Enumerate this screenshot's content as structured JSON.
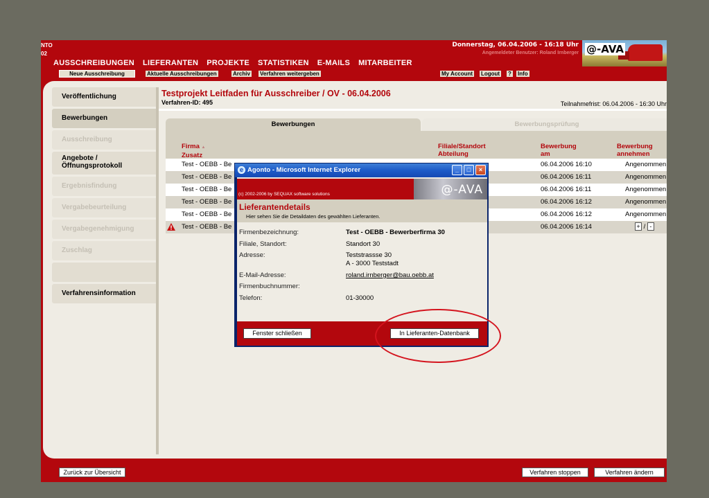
{
  "header": {
    "left_lines": [
      "NTO",
      "02"
    ],
    "date_time": "Donnerstag, 06.04.2006 - 16:18 Uhr",
    "user": "Angemeldeter Benutzer: Roland Irnberger",
    "logo_text": "@-AVA"
  },
  "main_nav": [
    {
      "label": "AUSSCHREIBUNGEN",
      "state": "active"
    },
    {
      "label": "LIEFERANTEN",
      "state": "inactive"
    },
    {
      "label": "PROJEKTE",
      "state": "inactive"
    },
    {
      "label": "STATISTIKEN",
      "state": "inactive"
    },
    {
      "label": "E-MAILS",
      "state": "inactive"
    },
    {
      "label": "MITARBEITER",
      "state": "inactive"
    }
  ],
  "sub_nav": {
    "new_tender": "Neue Ausschreibung",
    "current": "Aktuelle Ausschreibungen",
    "archive": "Archiv",
    "forward": "Verfahren weitergeben",
    "my_account": "My Account",
    "logout": "Logout",
    "help": "?",
    "info": "Info"
  },
  "sidebar": [
    {
      "label": "Veröffentlichung",
      "state": "normal"
    },
    {
      "label": "Bewerbungen",
      "state": "active"
    },
    {
      "label": "Ausschreibung",
      "state": "disabled"
    },
    {
      "label": "Angebote /",
      "label2": "Öffnungsprotokoll",
      "state": "normal"
    },
    {
      "label": "Ergebnisfindung",
      "state": "disabled"
    },
    {
      "label": "Vergabebeurteilung",
      "state": "disabled"
    },
    {
      "label": "Vergabegenehmigung",
      "state": "disabled"
    },
    {
      "label": "Zuschlag",
      "state": "disabled"
    },
    {
      "label": "",
      "state": "blank"
    },
    {
      "label": "Verfahrensinformation",
      "state": "normal"
    }
  ],
  "page": {
    "title": "Testprojekt Leitfaden für Ausschreiber / OV - 06.04.2006",
    "procedure_id": "Verfahren-ID: 495",
    "deadline": "Teilnahmefrist: 06.04.2006 - 16:30 Uhr"
  },
  "tabs": {
    "active": "Bewerbungen",
    "inactive": "Bewerbungsprüfung"
  },
  "table": {
    "headers": {
      "company": "Firma",
      "company_sort": "▲",
      "company2": "Zusatz",
      "branch": "Filiale/Standort",
      "branch2": "Abteilung",
      "applied": "Bewerbung",
      "applied2": "am",
      "accept": "Bewerbung",
      "accept2": "annehmen"
    },
    "rows": [
      {
        "company": "Test - OEBB - Be",
        "date": "06.04.2006 16:10",
        "status": "Angenommen"
      },
      {
        "company": "Test - OEBB - Be",
        "date": "06.04.2006 16:11",
        "status": "Angenommen"
      },
      {
        "company": "Test - OEBB - Be",
        "date": "06.04.2006 16:11",
        "status": "Angenommen"
      },
      {
        "company": "Test - OEBB - Be",
        "date": "06.04.2006 16:12",
        "status": "Angenommen"
      },
      {
        "company": "Test - OEBB - Be",
        "date": "06.04.2006 16:12",
        "status": "Angenommen"
      },
      {
        "company": "Test - OEBB - Be",
        "date": "06.04.2006 16:14",
        "status": "",
        "accept_plus": "+",
        "accept_sep": "/",
        "accept_minus": "-"
      }
    ]
  },
  "footer": {
    "back": "Zurück zur Übersicht",
    "stop": "Verfahren stoppen",
    "change": "Verfahren ändern"
  },
  "popup": {
    "title": "Agonto - Microsoft Internet Explorer",
    "ie_icon": "e",
    "copyright": "(c) 2002-2006 by SEQUAX software solutions",
    "logo_text": "@-AVA",
    "section_title": "Lieferantendetails",
    "section_sub": "Hier sehen Sie die Detaildaten des gewählten Lieferanten.",
    "fields": {
      "company_label": "Firmenbezeichnung:",
      "company_value": "Test - OEBB - Bewerberfirma 30",
      "branch_label": "Filiale, Standort:",
      "branch_value": "Standort 30",
      "address_label": "Adresse:",
      "address_line1": "Teststrassse 30",
      "address_line2": "A - 3000 Teststadt",
      "email_label": "E-Mail-Adresse:",
      "email_value": "roland.irnberger@bau.oebb.at",
      "book_label": "Firmenbuchnummer:",
      "phone_label": "Telefon:",
      "phone_value": "01-30000"
    },
    "close_button": "Fenster schließen",
    "db_button": "In Lieferanten-Datenbank"
  },
  "colors": {
    "brand_red": "#b3070d",
    "panel_beige": "#efece4",
    "xp_blue": "#1d5bc8",
    "annotation_red": "#d4141e"
  }
}
